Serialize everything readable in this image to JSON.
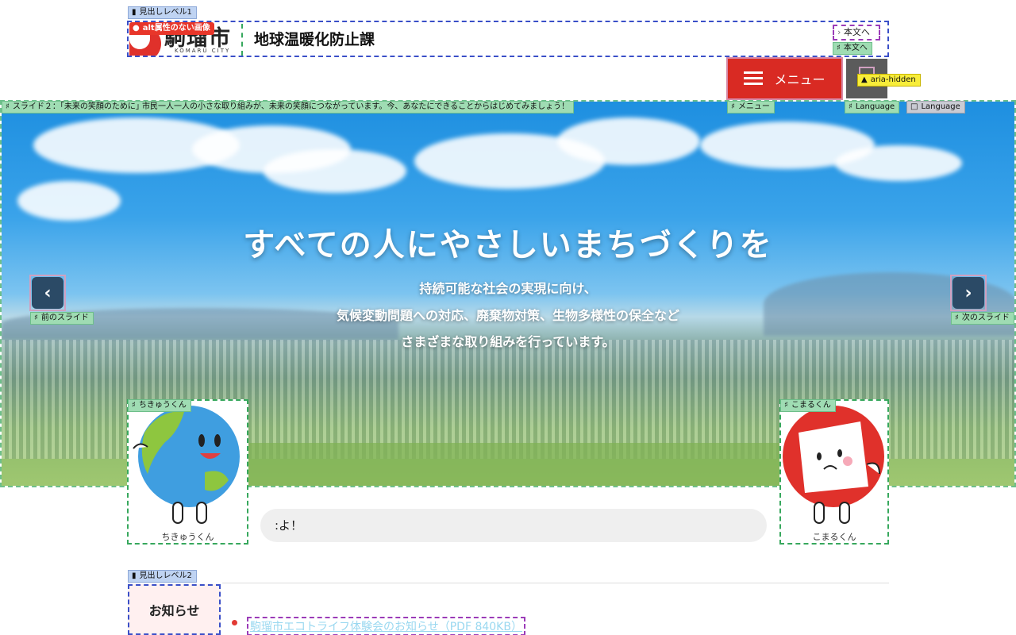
{
  "checker_tags": {
    "heading1": "見出しレベル1",
    "alt_missing": "alt属性のない画像",
    "skip_link_label": "本文へ",
    "menu": "メニュー",
    "language_a": "Language",
    "language_b": "Language",
    "aria_hidden": "aria-hidden",
    "slide_label": "スライド２：｢未来の笑顔のために｣ 市民一人一人の小さな取り組みが、未来の笑顔につながっています。今、あなたにできることからはじめてみましょう！",
    "prev_slide": "前のスライド",
    "next_slide": "次のスライド",
    "mascot_left": "ちきゅうくん",
    "mascot_right": "こまるくん",
    "heading2": "見出しレベル2"
  },
  "header": {
    "logo_text": "駒瑠市",
    "logo_sub": "KOMARU CITY",
    "site_title": "地球温暖化防止課",
    "skip_link": "本文へ",
    "menu_label": "メニュー"
  },
  "hero": {
    "title": "すべての人にやさしいまちづくりを",
    "lines": [
      "持続可能な社会の実現に向け、",
      "気候変動問題への対応、廃棄物対策、生物多様性の保全など",
      "さまざまな取り組みを行っています。"
    ],
    "prev_icon": "chevron-left-icon",
    "next_icon": "chevron-right-icon"
  },
  "mascots": {
    "left_name": "ちきゅうくん",
    "right_name": "こまるくん"
  },
  "speech": {
    "text": ":よ！"
  },
  "news": {
    "heading": "お知らせ",
    "items": [
      {
        "text": "駒瑠市エコトライフ体験会のお知らせ（PDF 840KB）"
      }
    ]
  },
  "colors": {
    "brand_red": "#d92a23",
    "lang_grey": "#5b5b5b",
    "slider_arrow": "#2b4a66"
  }
}
